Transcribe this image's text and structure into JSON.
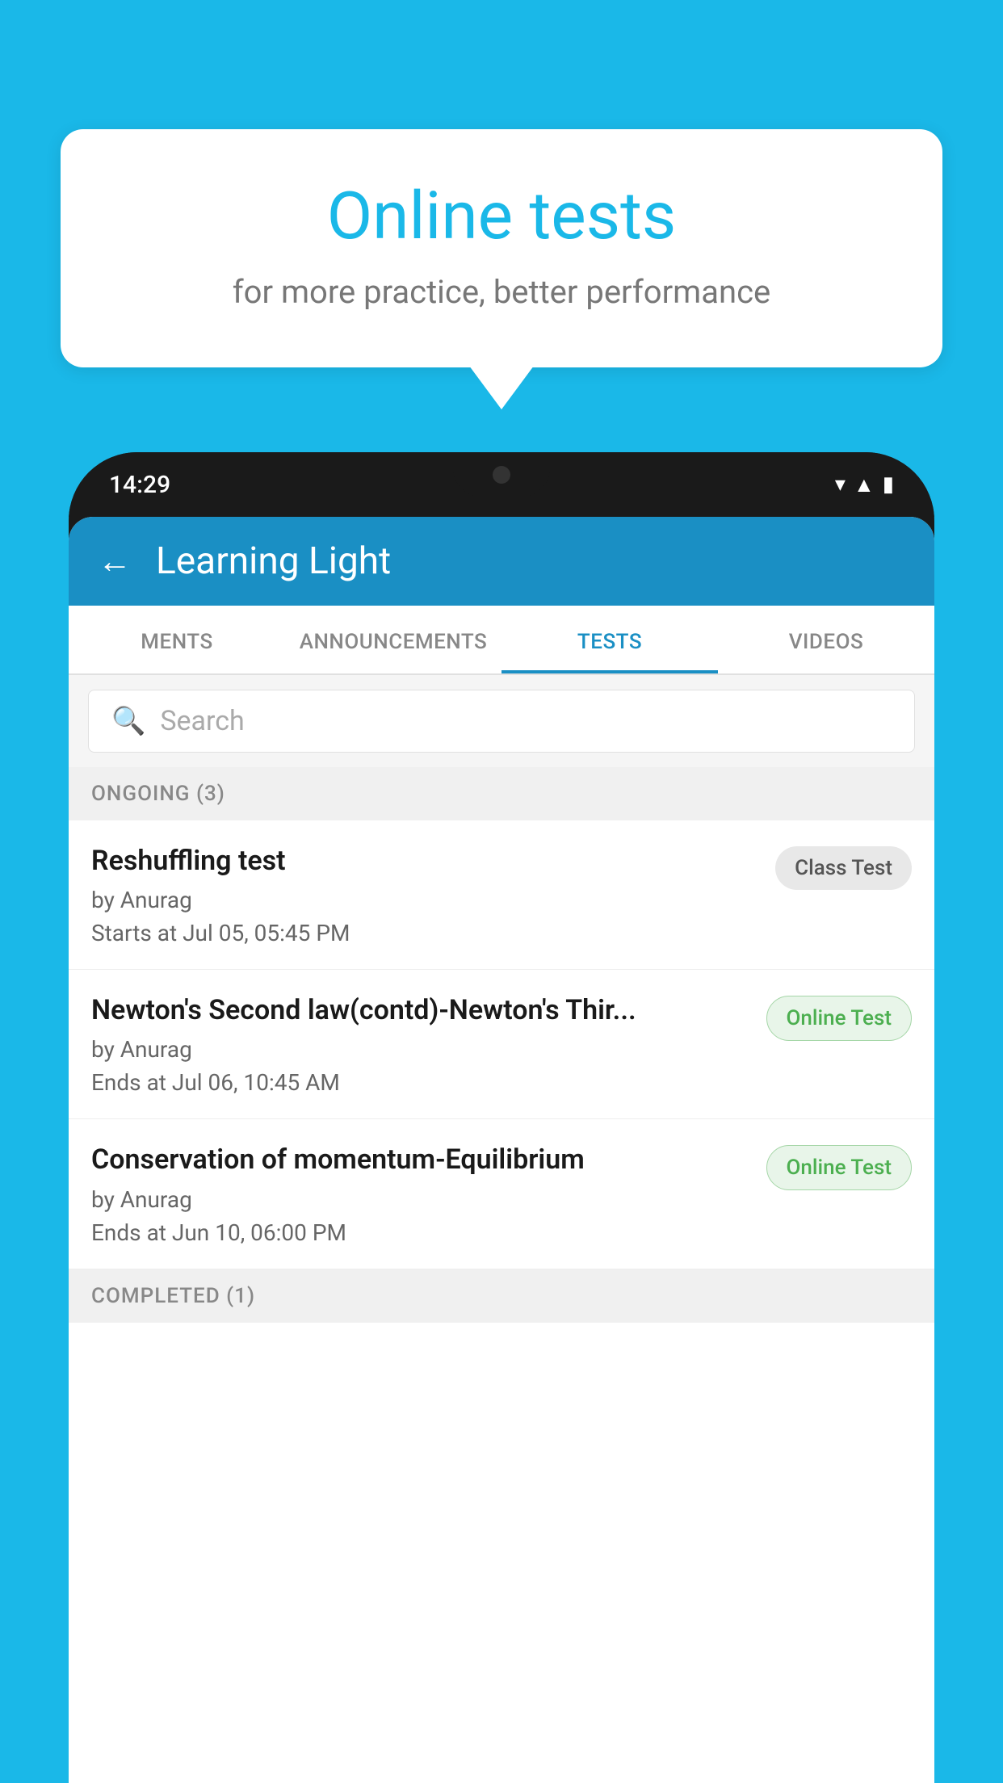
{
  "background_color": "#1ab8e8",
  "speech_bubble": {
    "title": "Online tests",
    "subtitle": "for more practice, better performance"
  },
  "phone": {
    "status_bar": {
      "time": "14:29"
    },
    "header": {
      "title": "Learning Light",
      "back_label": "←"
    },
    "tabs": [
      {
        "label": "MENTS",
        "active": false
      },
      {
        "label": "ANNOUNCEMENTS",
        "active": false
      },
      {
        "label": "TESTS",
        "active": true
      },
      {
        "label": "VIDEOS",
        "active": false
      }
    ],
    "search": {
      "placeholder": "Search"
    },
    "ongoing_section": {
      "label": "ONGOING (3)"
    },
    "tests": [
      {
        "name": "Reshuffling test",
        "author": "by Anurag",
        "time_label": "Starts at",
        "time": "Jul 05, 05:45 PM",
        "badge": "Class Test",
        "badge_type": "class"
      },
      {
        "name": "Newton's Second law(contd)-Newton's Thir...",
        "author": "by Anurag",
        "time_label": "Ends at",
        "time": "Jul 06, 10:45 AM",
        "badge": "Online Test",
        "badge_type": "online"
      },
      {
        "name": "Conservation of momentum-Equilibrium",
        "author": "by Anurag",
        "time_label": "Ends at",
        "time": "Jun 10, 06:00 PM",
        "badge": "Online Test",
        "badge_type": "online"
      }
    ],
    "completed_section": {
      "label": "COMPLETED (1)"
    }
  }
}
